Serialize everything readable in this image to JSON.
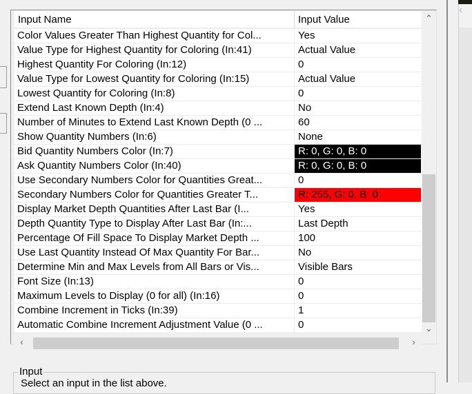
{
  "table": {
    "headers": {
      "name": "Input Name",
      "value": "Input Value"
    },
    "rows": [
      {
        "name": "Color Values Greater Than Highest Quantity for Col...",
        "value": "Yes"
      },
      {
        "name": "Value Type for Highest Quantity for Coloring   (In:41)",
        "value": "Actual Value"
      },
      {
        "name": "Highest Quantity For Coloring   (In:12)",
        "value": "0"
      },
      {
        "name": "Value Type for Lowest Quantity for Coloring   (In:15)",
        "value": "Actual Value"
      },
      {
        "name": "Lowest Quantity for Coloring   (In:8)",
        "value": "0"
      },
      {
        "name": "Extend Last Known Depth   (In:4)",
        "value": "No"
      },
      {
        "name": "Number of Minutes to Extend Last Known Depth (0 ...",
        "value": "60"
      },
      {
        "name": "Show Quantity Numbers   (In:6)",
        "value": "None"
      },
      {
        "name": "Bid Quantity Numbers Color   (In:7)",
        "value": "R: 0, G: 0, B: 0",
        "bg": "#000000",
        "fg": "#ffffff"
      },
      {
        "name": "Ask Quantity Numbers Color   (In:40)",
        "value": "R: 0, G: 0, B: 0",
        "bg": "#000000",
        "fg": "#ffffff"
      },
      {
        "name": "Use Secondary Numbers Color for Quantities Great...",
        "value": "0"
      },
      {
        "name": "Secondary Numbers Color for Quantities Greater T...",
        "value": "R: 255, G: 0, B: 0",
        "bg": "#ff0000",
        "fg": "#000000"
      },
      {
        "name": "Display Market Depth Quantities After Last Bar   (I...",
        "value": "Yes"
      },
      {
        "name": "Depth Quantity Type to Display After Last Bar   (In:...",
        "value": "Last Depth"
      },
      {
        "name": "Percentage Of Fill Space To Display Market Depth ...",
        "value": "100"
      },
      {
        "name": "Use Last Quantity Instead Of Max Quantity For Bar...",
        "value": "No"
      },
      {
        "name": "Determine Min and Max Levels from All Bars or Vis...",
        "value": "Visible Bars"
      },
      {
        "name": "Font Size   (In:13)",
        "value": "0"
      },
      {
        "name": "Maximum Levels to Display (0 for all)   (In:16)",
        "value": "0"
      },
      {
        "name": "Combine Increment in Ticks   (In:39)",
        "value": "1"
      },
      {
        "name": "Automatic Combine Increment Adjustment Value (0 ...",
        "value": "0"
      }
    ]
  },
  "input_group": {
    "label": "Input",
    "message": "Select an input in the list above."
  }
}
